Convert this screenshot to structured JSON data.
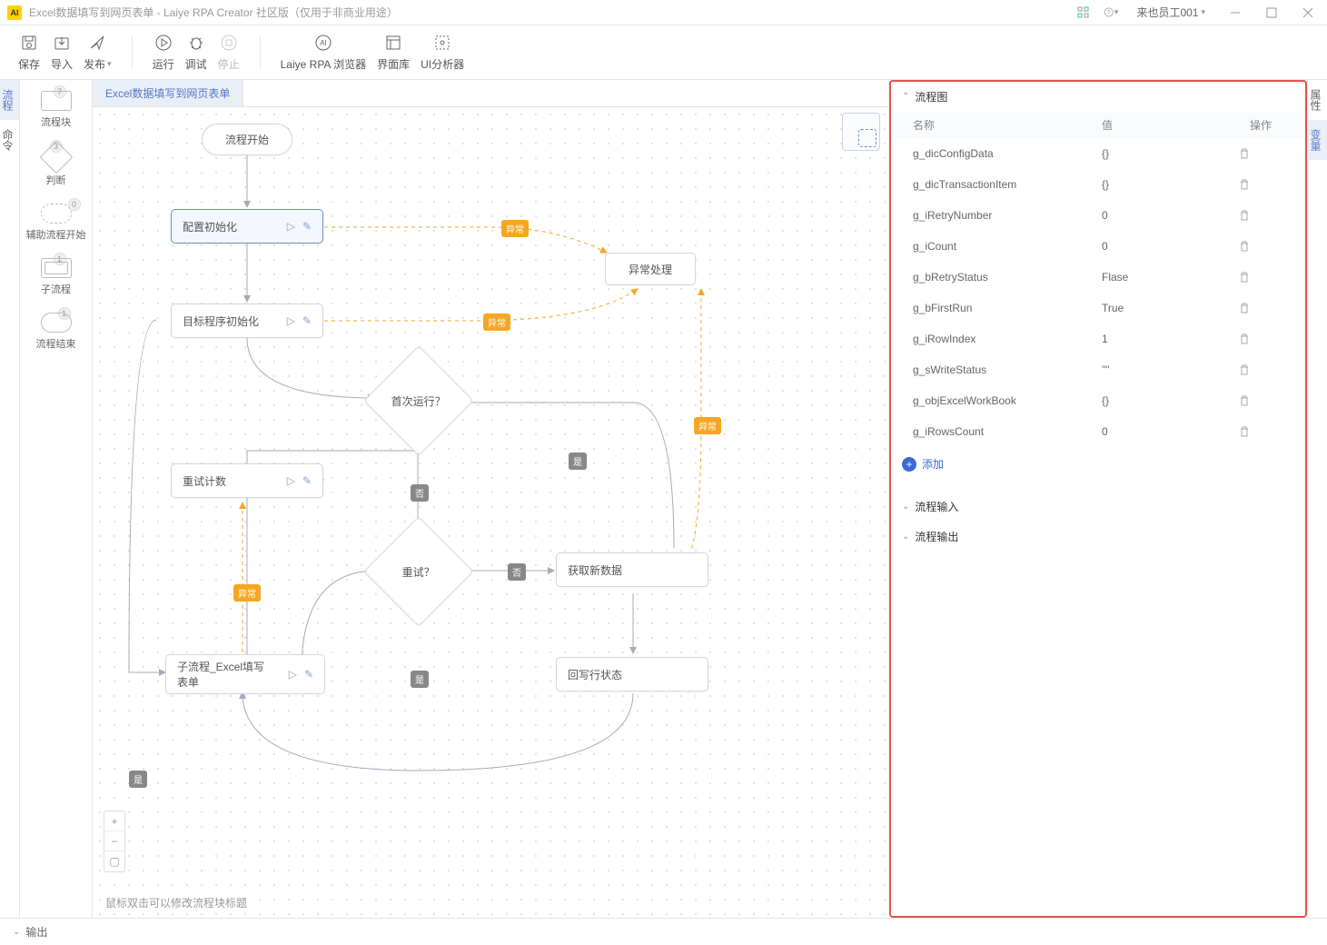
{
  "titlebar": {
    "title": "Excel数据填写到网页表单 - Laiye RPA Creator 社区版（仅用于非商业用途）",
    "user": "来也员工001"
  },
  "toolbar": {
    "save": "保存",
    "import": "导入",
    "publish": "发布",
    "run": "运行",
    "debug": "调试",
    "stop": "停止",
    "browser": "Laiye RPA 浏览器",
    "lib": "界面库",
    "analyzer": "UI分析器"
  },
  "leftTabs": {
    "flow": "流程",
    "cmd": "命令"
  },
  "palette": {
    "block": {
      "label": "流程块",
      "badge": "7"
    },
    "decision": {
      "label": "判断",
      "badge": "3"
    },
    "aux": {
      "label": "辅助流程开始",
      "badge": "0"
    },
    "subflow": {
      "label": "子流程",
      "badge": "1"
    },
    "end": {
      "label": "流程结束",
      "badge": "1"
    }
  },
  "canvas": {
    "tab": "Excel数据填写到网页表单",
    "nodes": {
      "start": "流程开始",
      "config": "配置初始化",
      "targetInit": "目标程序初始化",
      "firstRun": "首次运行？",
      "retryCount": "重试计数",
      "retry": "重试？",
      "subflow": "子流程_Excel填写表单",
      "exception": "异常处理",
      "fetchNew": "获取新数据",
      "writeBack": "回写行状态"
    },
    "labels": {
      "exception": "异常",
      "yes": "是",
      "no": "否"
    },
    "hint": "鼠标双击可以修改流程块标题"
  },
  "panel": {
    "section1": "流程图",
    "colName": "名称",
    "colValue": "值",
    "colOp": "操作",
    "rows": [
      {
        "name": "g_dicConfigData",
        "value": "{}"
      },
      {
        "name": "g_dicTransactionItem",
        "value": "{}"
      },
      {
        "name": "g_iRetryNumber",
        "value": "0"
      },
      {
        "name": "g_iCount",
        "value": "0"
      },
      {
        "name": "g_bRetryStatus",
        "value": "Flase"
      },
      {
        "name": "g_bFirstRun",
        "value": "True"
      },
      {
        "name": "g_iRowIndex",
        "value": "1"
      },
      {
        "name": "g_sWriteStatus",
        "value": "\"\""
      },
      {
        "name": "g_objExcelWorkBook",
        "value": "{}"
      },
      {
        "name": "g_iRowsCount",
        "value": "0"
      }
    ],
    "add": "添加",
    "section2": "流程输入",
    "section3": "流程输出"
  },
  "rightTabs": {
    "props": "属性",
    "vars": "变量"
  },
  "bottom": {
    "output": "输出"
  }
}
